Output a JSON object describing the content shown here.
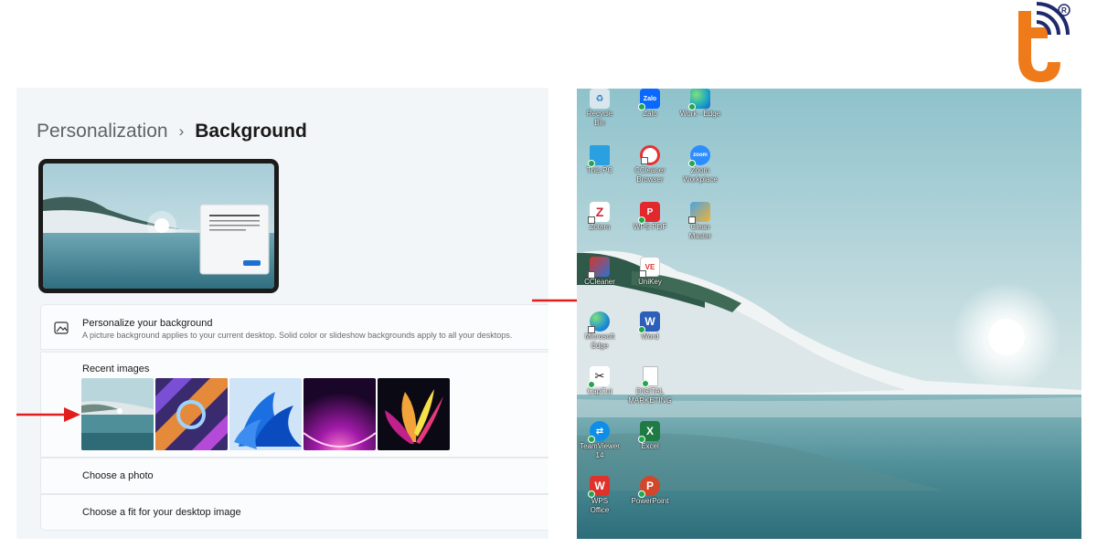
{
  "settings": {
    "breadcrumb": {
      "parent": "Personalization",
      "separator": "›",
      "current": "Background"
    },
    "personalize": {
      "title": "Personalize your background",
      "description": "A picture background applies to your current desktop. Solid color or slideshow backgrounds apply to all your desktops.",
      "icon": "picture-icon"
    },
    "recent_images": {
      "label": "Recent images",
      "items": [
        "lake-landscape",
        "abstract-glass",
        "blue-bloom",
        "purple-glow",
        "colorful-flower"
      ]
    },
    "choose_photo": "Choose a photo",
    "choose_fit": "Choose a fit for your desktop image"
  },
  "desktop": {
    "icons": [
      {
        "label": "Recycle Bin",
        "icon": "recycle-bin-icon",
        "color": "#d9e6ee"
      },
      {
        "label": "Zalo",
        "icon": "zalo-icon",
        "color": "#0a68ff",
        "glyph": "Zalo"
      },
      {
        "label": "Work - Edge",
        "icon": "edge-icon",
        "color": "#1aa3c8"
      },
      {
        "label": "This PC",
        "icon": "monitor-icon",
        "color": "#2aa0e0"
      },
      {
        "label": "CCleaner Browser",
        "icon": "ccleaner-browser-icon",
        "color": "#e83131"
      },
      {
        "label": "Zoom Workplace",
        "icon": "zoom-icon",
        "color": "#2d8cff",
        "glyph": "zoom"
      },
      {
        "label": "Zotero",
        "icon": "zotero-icon",
        "color": "#cc2936",
        "glyph": "Z"
      },
      {
        "label": "WPS PDF",
        "icon": "wps-pdf-icon",
        "color": "#e0282e",
        "glyph": "P"
      },
      {
        "label": "Clean Master",
        "icon": "broom-icon",
        "color": "#f2b233"
      },
      {
        "label": "CCleaner",
        "icon": "ccleaner-icon",
        "color": "#d9342b"
      },
      {
        "label": "UniKey",
        "icon": "unikey-icon",
        "color": "#ffffff",
        "glyph": "VE"
      },
      {
        "label": "Microsoft Edge",
        "icon": "edge-icon",
        "color": "#1d8fd6"
      },
      {
        "label": "Word",
        "icon": "word-icon",
        "color": "#2b5fb9",
        "glyph": "W"
      },
      {
        "label": "CapCut",
        "icon": "capcut-icon",
        "color": "#111111"
      },
      {
        "label": "DIGITAL MARKETING",
        "icon": "document-icon",
        "color": "#ffffff"
      },
      {
        "label": "TeamViewer 14",
        "icon": "teamviewer-icon",
        "color": "#0e8ee9"
      },
      {
        "label": "Excel",
        "icon": "excel-icon",
        "color": "#1f7a44",
        "glyph": "X"
      },
      {
        "label": "WPS Office",
        "icon": "wps-office-icon",
        "color": "#e0322b",
        "glyph": "W"
      },
      {
        "label": "PowerPoint",
        "icon": "powerpoint-icon",
        "color": "#d2472a",
        "glyph": "P"
      }
    ]
  },
  "colors": {
    "arrow": "#e21d1d",
    "brand": "#ef7a1a",
    "brand_dark": "#1f2a6b"
  }
}
